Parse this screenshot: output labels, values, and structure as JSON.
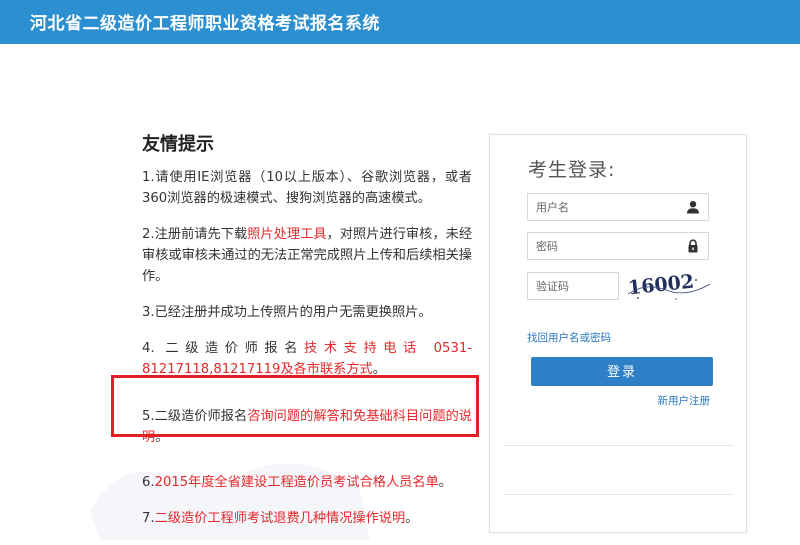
{
  "header": {
    "title": "河北省二级造价工程师职业资格考试报名系统"
  },
  "notice": {
    "title": "友情提示",
    "items": [
      {
        "prefix": "1.请使用IE浏览器（10以上版本）、谷歌浏览器，或者360浏览器的极速模式、搜狗浏览器的高速模式。",
        "link": "",
        "suffix": ""
      },
      {
        "prefix": "2.注册前请先下载",
        "link": "照片处理工具",
        "suffix": "，对照片进行审核，未经审核或审核未通过的无法正常完成照片上传和后续相关操作。"
      },
      {
        "prefix": "3.已经注册并成功上传照片的用户无需更换照片。",
        "link": "",
        "suffix": ""
      },
      {
        "prefix": "4. 二级造价师报名",
        "link": "技术支持电话 0531-81217118,81217119及各市联系方式",
        "suffix": "。"
      },
      {
        "prefix": "5.二级造价师报名",
        "link": "咨询问题的解答和免基础科目问题的说明",
        "suffix": "。"
      },
      {
        "prefix": "6.",
        "link": "2015年度全省建设工程造价员考试合格人员名单",
        "suffix": "。"
      },
      {
        "prefix": "7.",
        "link": "二级造价工程师考试退费几种情况操作说明",
        "suffix": "。"
      }
    ]
  },
  "login": {
    "title": "考生登录:",
    "username_placeholder": "用户名",
    "password_placeholder": "密码",
    "captcha_placeholder": "验证码",
    "captcha_text": "16002",
    "forgot": "找回用户名或密码",
    "submit": "登录",
    "register": "新用户注册"
  },
  "icons": {
    "username": "user-icon",
    "password": "lock-icon"
  },
  "colors": {
    "header": "#2b8fd0",
    "link_red": "#e5292d",
    "button": "#2e7fc6",
    "highlight_border": "#e01f26"
  }
}
